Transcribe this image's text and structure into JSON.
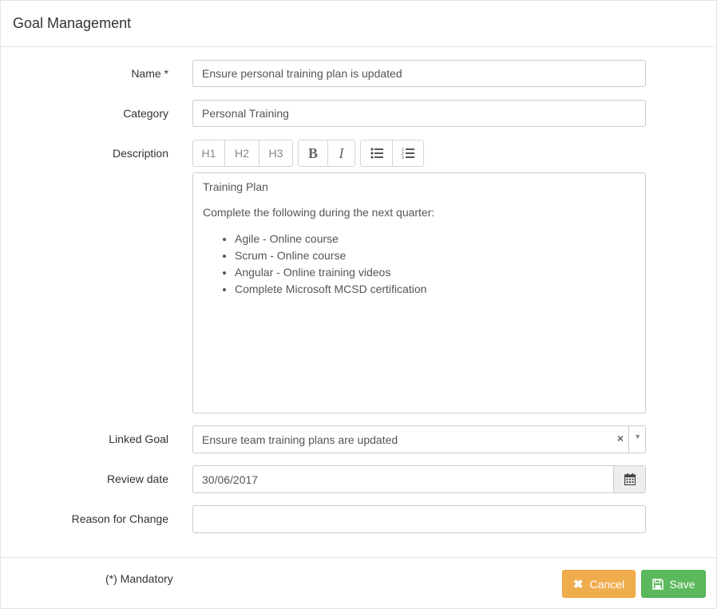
{
  "header": {
    "title": "Goal Management"
  },
  "form": {
    "name": {
      "label": "Name *",
      "value": "Ensure personal training plan is updated"
    },
    "category": {
      "label": "Category",
      "value": "Personal Training"
    },
    "description": {
      "label": "Description",
      "toolbar": {
        "h1": "H1",
        "h2": "H2",
        "h3": "H3",
        "bold": "B",
        "italic": "I"
      },
      "content": {
        "heading": "Training Plan",
        "intro": "Complete the following during the next quarter:",
        "items": [
          "Agile - Online course",
          "Scrum - Online course",
          "Angular - Online training videos",
          "Complete Microsoft MCSD certification"
        ]
      }
    },
    "linked_goal": {
      "label": "Linked Goal",
      "value": "Ensure team training plans are updated",
      "clear": "×"
    },
    "review_date": {
      "label": "Review date",
      "value": "30/06/2017"
    },
    "reason": {
      "label": "Reason for Change",
      "value": ""
    }
  },
  "footer": {
    "mandatory": "(*) Mandatory",
    "cancel_label": "Cancel",
    "save_label": "Save"
  },
  "colors": {
    "cancel": "#f0ad4e",
    "save": "#5cb85c"
  }
}
